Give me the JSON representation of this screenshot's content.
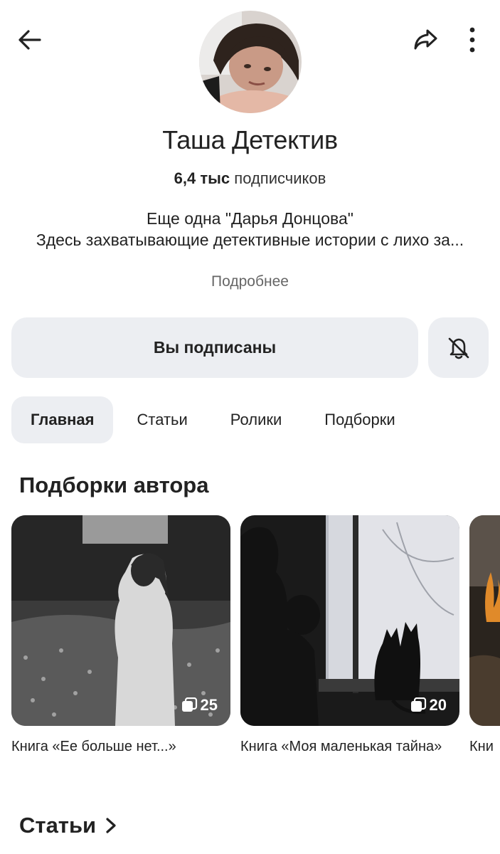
{
  "profile": {
    "name": "Таша Детектив",
    "subscribers_count": "6,4 тыс",
    "subscribers_label": "подписчиков",
    "description_line1": "Еще одна \"Дарья Донцова\"",
    "description_line2": "Здесь захватывающие детективные истории с лихо за...",
    "more_label": "Подробнее"
  },
  "actions": {
    "subscribed_label": "Вы подписаны"
  },
  "tabs": [
    {
      "label": "Главная",
      "active": true
    },
    {
      "label": "Статьи",
      "active": false
    },
    {
      "label": "Ролики",
      "active": false
    },
    {
      "label": "Подборки",
      "active": false
    }
  ],
  "collections": {
    "title": "Подборки автора",
    "items": [
      {
        "title": "Книга «Ее больше нет...»",
        "count": "25"
      },
      {
        "title": "Книга «Моя маленькая тайна»",
        "count": "20"
      },
      {
        "title": "Кни",
        "count": ""
      }
    ]
  },
  "articles": {
    "title": "Статьи"
  },
  "icons": {
    "back": "arrow-left-icon",
    "share": "share-icon",
    "more": "more-vertical-icon",
    "bell": "bell-off-icon",
    "collection": "stack-icon",
    "chevron": "chevron-right-icon"
  }
}
